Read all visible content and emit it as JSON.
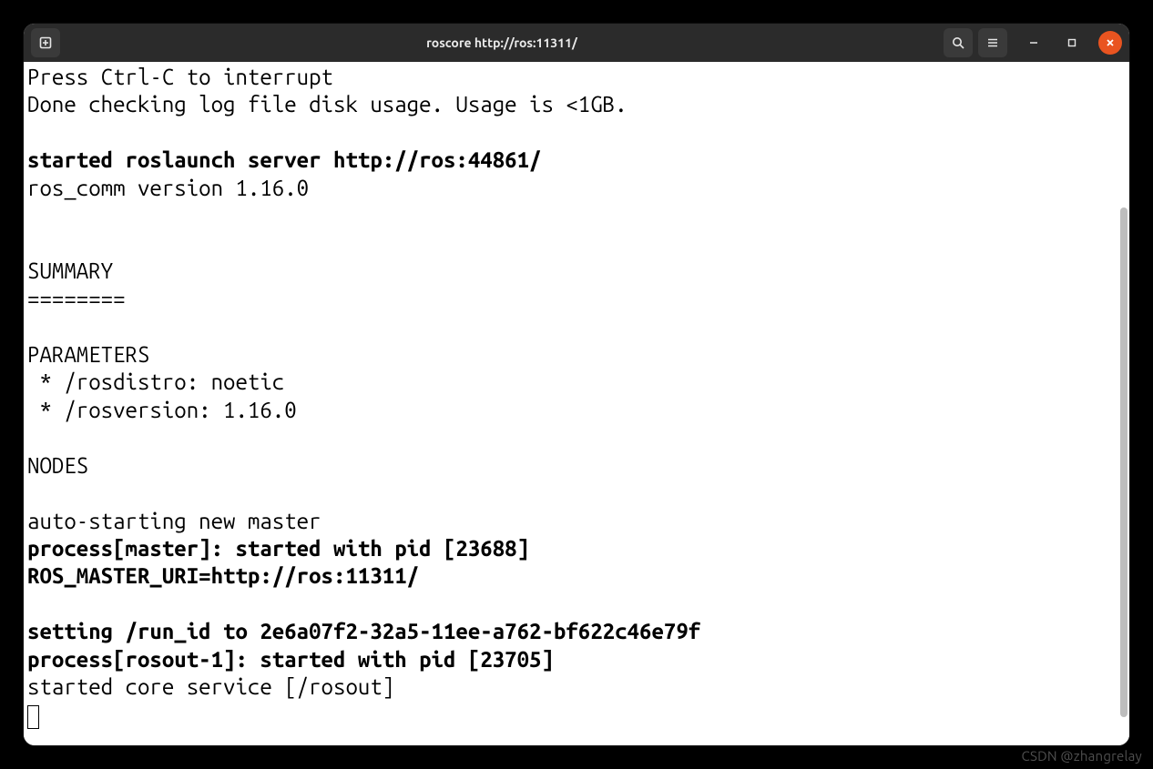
{
  "window": {
    "title": "roscore http://ros:11311/"
  },
  "titlebar": {
    "left_button": "new-tab",
    "right_buttons": [
      "search",
      "menu",
      "minimize",
      "maximize",
      "close"
    ]
  },
  "terminal": {
    "lines": [
      {
        "text": "Press Ctrl-C to interrupt",
        "bold": false
      },
      {
        "text": "Done checking log file disk usage. Usage is <1GB.",
        "bold": false
      },
      {
        "text": "",
        "bold": false
      },
      {
        "text": "started roslaunch server http://ros:44861/",
        "bold": true
      },
      {
        "text": "ros_comm version 1.16.0",
        "bold": false
      },
      {
        "text": "",
        "bold": false
      },
      {
        "text": "",
        "bold": false
      },
      {
        "text": "SUMMARY",
        "bold": false
      },
      {
        "text": "========",
        "bold": false
      },
      {
        "text": "",
        "bold": false
      },
      {
        "text": "PARAMETERS",
        "bold": false
      },
      {
        "text": " * /rosdistro: noetic",
        "bold": false
      },
      {
        "text": " * /rosversion: 1.16.0",
        "bold": false
      },
      {
        "text": "",
        "bold": false
      },
      {
        "text": "NODES",
        "bold": false
      },
      {
        "text": "",
        "bold": false
      },
      {
        "text": "auto-starting new master",
        "bold": false
      },
      {
        "text": "process[master]: started with pid [23688]",
        "bold": true
      },
      {
        "text": "ROS_MASTER_URI=http://ros:11311/",
        "bold": true
      },
      {
        "text": "",
        "bold": false
      },
      {
        "text": "setting /run_id to 2e6a07f2-32a5-11ee-a762-bf622c46e79f",
        "bold": true
      },
      {
        "text": "process[rosout-1]: started with pid [23705]",
        "bold": true
      },
      {
        "text": "started core service [/rosout]",
        "bold": false
      }
    ]
  },
  "watermark": "CSDN @zhangrelay",
  "colors": {
    "titlebar_bg": "#2b2b2b",
    "close_bg": "#e95420",
    "terminal_bg": "#ffffff",
    "terminal_fg": "#000000"
  }
}
